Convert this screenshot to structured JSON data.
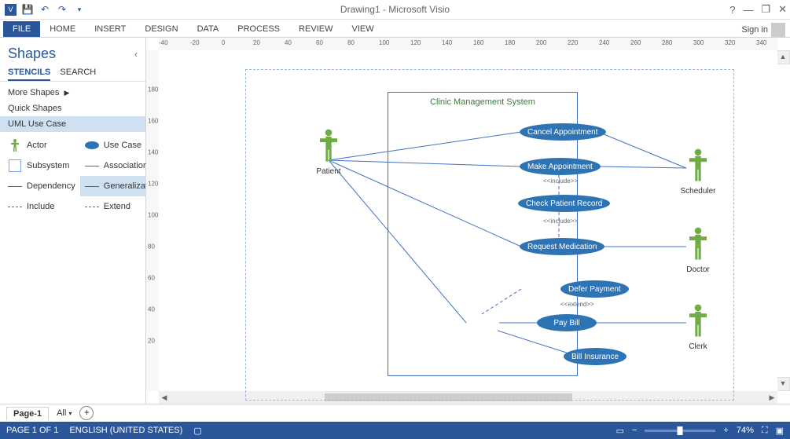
{
  "app": {
    "title": "Drawing1 - Microsoft Visio",
    "signin": "Sign in"
  },
  "ribbon": {
    "file": "FILE",
    "tabs": [
      "HOME",
      "INSERT",
      "DESIGN",
      "DATA",
      "PROCESS",
      "REVIEW",
      "VIEW"
    ]
  },
  "shapes_pane": {
    "title": "Shapes",
    "tabs": {
      "stencils": "STENCILS",
      "search": "SEARCH"
    },
    "stencils": {
      "more": "More Shapes",
      "quick": "Quick Shapes",
      "uml": "UML Use Case"
    },
    "shapes": {
      "actor": "Actor",
      "usecase": "Use Case",
      "subsystem": "Subsystem",
      "association": "Association",
      "dependency": "Dependency",
      "generalization": "Generalizati...",
      "include": "Include",
      "extend": "Extend"
    }
  },
  "diagram": {
    "system_title": "Clinic Management System",
    "actors": {
      "patient": "Patient",
      "scheduler": "Scheduler",
      "doctor": "Doctor",
      "clerk": "Clerk"
    },
    "usecases": {
      "cancel": "Cancel Appointment",
      "make": "Make Appointment",
      "check": "Check Patient Record",
      "request": "Request Medication",
      "defer": "Defer Payment",
      "pay": "Pay Bill",
      "insure": "Bill Insurance"
    },
    "stereotypes": {
      "include1": "<<include>>",
      "include2": "<<include>>",
      "extend": "<<extend>>"
    }
  },
  "ruler_h": [
    "-40",
    "-20",
    "0",
    "20",
    "40",
    "60",
    "80",
    "100",
    "120",
    "140",
    "160",
    "180",
    "200",
    "220",
    "240",
    "260",
    "280",
    "300",
    "320",
    "340"
  ],
  "ruler_v": [
    "180",
    "160",
    "140",
    "120",
    "100",
    "80",
    "60",
    "40",
    "20"
  ],
  "page_tabs": {
    "page1": "Page-1",
    "all": "All"
  },
  "status": {
    "page": "PAGE 1 OF 1",
    "lang": "ENGLISH (UNITED STATES)",
    "zoom": "74%"
  }
}
